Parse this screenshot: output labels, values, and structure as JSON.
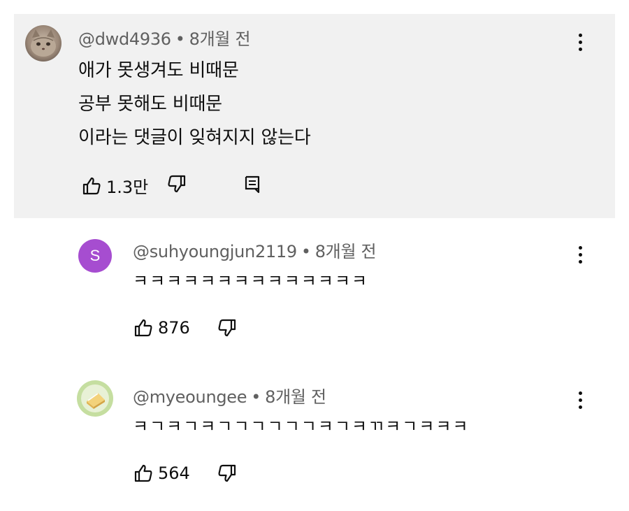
{
  "comments": [
    {
      "handle": "@dwd4936",
      "time": "8개월 전",
      "lines": [
        "애가 못생겨도 비때문",
        "공부 못해도 비때문",
        "이라는 댓글이 잊혀지지 않는다"
      ],
      "likes": "1.3만",
      "avatar_icon": "cat-avatar-icon"
    },
    {
      "handle": "@suhyoungjun2119",
      "time": "8개월 전",
      "avatar_letter": "S",
      "avatar_color": "#a64dd0",
      "lines": [
        "ㅋㅋㅋㅋㅋㅋㅋㅋㅋㅋㅋㅋㅋㅋ"
      ],
      "likes": "876"
    },
    {
      "handle": "@myeoungee",
      "time": "8개월 전",
      "lines": [
        "ㅋㄱㅋㄱㅋㄱㄱㄱㄱㄱㄱㅋㄱㅋㄲㅋㄱㅋㅋㅋ"
      ],
      "likes": "564",
      "avatar_icon": "cake-avatar-icon"
    }
  ],
  "separator": "•",
  "colors": {
    "top_comment_bg": "#f1f1f1",
    "meta_text": "#606060",
    "body_text": "#0f0f0f"
  }
}
